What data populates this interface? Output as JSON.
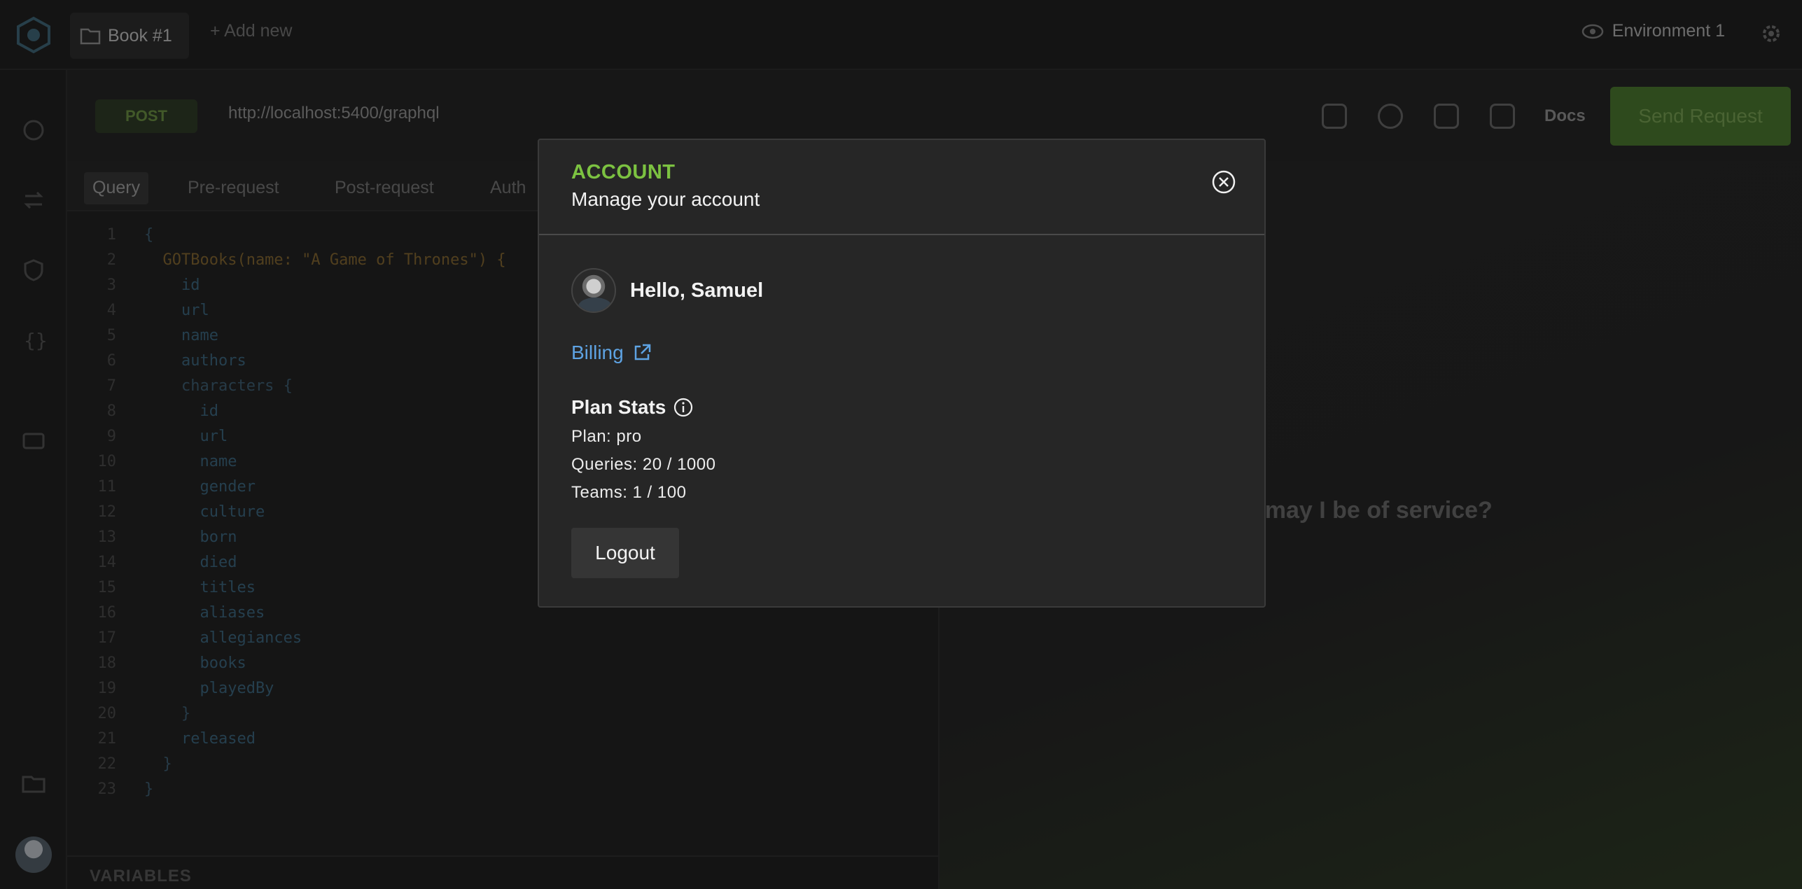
{
  "app": {
    "collection_tab": "Book #1",
    "add_new": "+ Add new",
    "environment": "Environment 1"
  },
  "request": {
    "method": "POST",
    "url": "http://localhost:5400/graphql",
    "docs_label": "Docs",
    "send_label": "Send Request"
  },
  "query_tabs": [
    "Query",
    "Pre-request",
    "Post-request",
    "Auth"
  ],
  "editor": {
    "lines": [
      {
        "n": "1",
        "text": "{"
      },
      {
        "n": "2",
        "text": "  GOTBooks(name: \"A Game of Thrones\") {"
      },
      {
        "n": "3",
        "text": "    id"
      },
      {
        "n": "4",
        "text": "    url"
      },
      {
        "n": "5",
        "text": "    name"
      },
      {
        "n": "6",
        "text": "    authors"
      },
      {
        "n": "7",
        "text": "    characters {"
      },
      {
        "n": "8",
        "text": "      id"
      },
      {
        "n": "9",
        "text": "      url"
      },
      {
        "n": "10",
        "text": "      name"
      },
      {
        "n": "11",
        "text": "      gender"
      },
      {
        "n": "12",
        "text": "      culture"
      },
      {
        "n": "13",
        "text": "      born"
      },
      {
        "n": "14",
        "text": "      died"
      },
      {
        "n": "15",
        "text": "      titles"
      },
      {
        "n": "16",
        "text": "      aliases"
      },
      {
        "n": "17",
        "text": "      allegiances"
      },
      {
        "n": "18",
        "text": "      books"
      },
      {
        "n": "19",
        "text": "      playedBy"
      },
      {
        "n": "20",
        "text": "    }"
      },
      {
        "n": "21",
        "text": "    released"
      },
      {
        "n": "22",
        "text": "  }"
      },
      {
        "n": "23",
        "text": "}"
      }
    ],
    "variables_label": "VARIABLES"
  },
  "right_panel": {
    "ai_greeting": "end, how may I be of service?"
  },
  "modal": {
    "title": "ACCOUNT",
    "subtitle": "Manage your account",
    "greeting": "Hello, Samuel",
    "billing_label": "Billing",
    "plan_stats_label": "Plan Stats",
    "plan": "Plan: pro",
    "queries": "Queries: 20 / 1000",
    "teams": "Teams: 1 / 100",
    "logout_label": "Logout"
  },
  "colors": {
    "accent_green": "#7cc241",
    "link_blue": "#5ea3e3"
  }
}
